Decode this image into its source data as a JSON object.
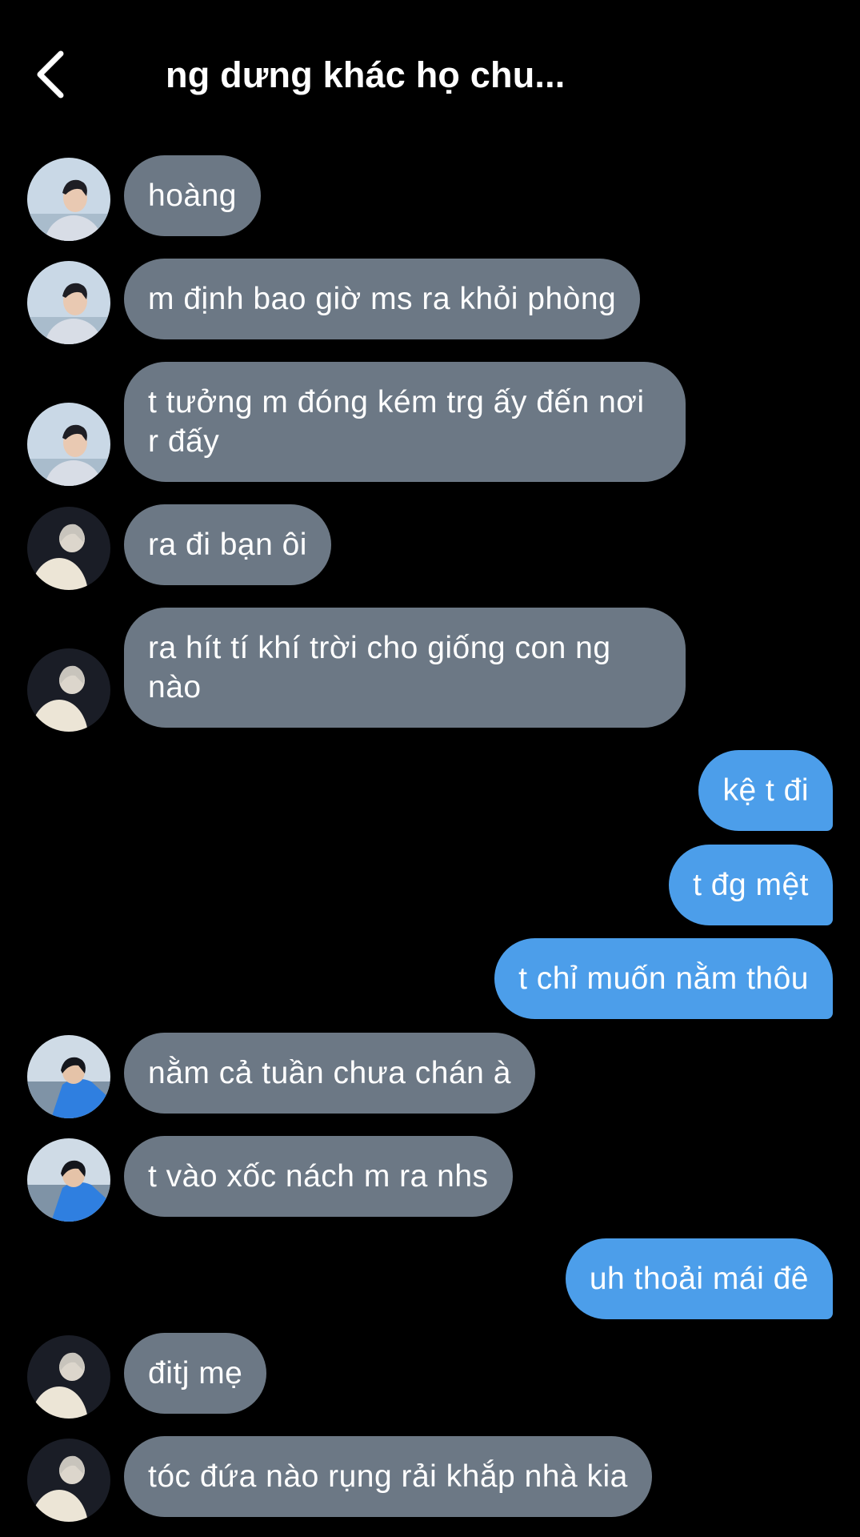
{
  "header": {
    "title": "ng dưng khác họ chu...",
    "back_icon": "chevron-left-icon"
  },
  "colors": {
    "background": "#000000",
    "incoming_bubble": "#6c7885",
    "outgoing_bubble": "#4c9eea",
    "text": "#ffffff"
  },
  "messages": [
    {
      "sender": "a",
      "direction": "incoming",
      "text": "hoàng"
    },
    {
      "sender": "a",
      "direction": "incoming",
      "text": "m định bao giờ ms ra khỏi phòng"
    },
    {
      "sender": "a",
      "direction": "incoming",
      "text": "t tưởng m đóng kém trg ấy đến nơi r đấy"
    },
    {
      "sender": "b",
      "direction": "incoming",
      "text": "ra đi bạn ôi"
    },
    {
      "sender": "b",
      "direction": "incoming",
      "text": "ra hít tí khí trời cho giống con ng nào"
    },
    {
      "sender": "me",
      "direction": "outgoing",
      "text": "kệ t đi"
    },
    {
      "sender": "me",
      "direction": "outgoing",
      "text": "t đg mệt"
    },
    {
      "sender": "me",
      "direction": "outgoing",
      "text": "t chỉ muốn nằm thôu"
    },
    {
      "sender": "c",
      "direction": "incoming",
      "text": "nằm cả tuần chưa chán à"
    },
    {
      "sender": "c",
      "direction": "incoming",
      "text": "t vào xốc nách m ra nhs"
    },
    {
      "sender": "me",
      "direction": "outgoing",
      "text": "uh thoải mái đê"
    },
    {
      "sender": "b",
      "direction": "incoming",
      "text": "đitj mẹ"
    },
    {
      "sender": "b",
      "direction": "incoming",
      "text": "tóc đứa nào rụng rải khắp nhà kia"
    }
  ]
}
